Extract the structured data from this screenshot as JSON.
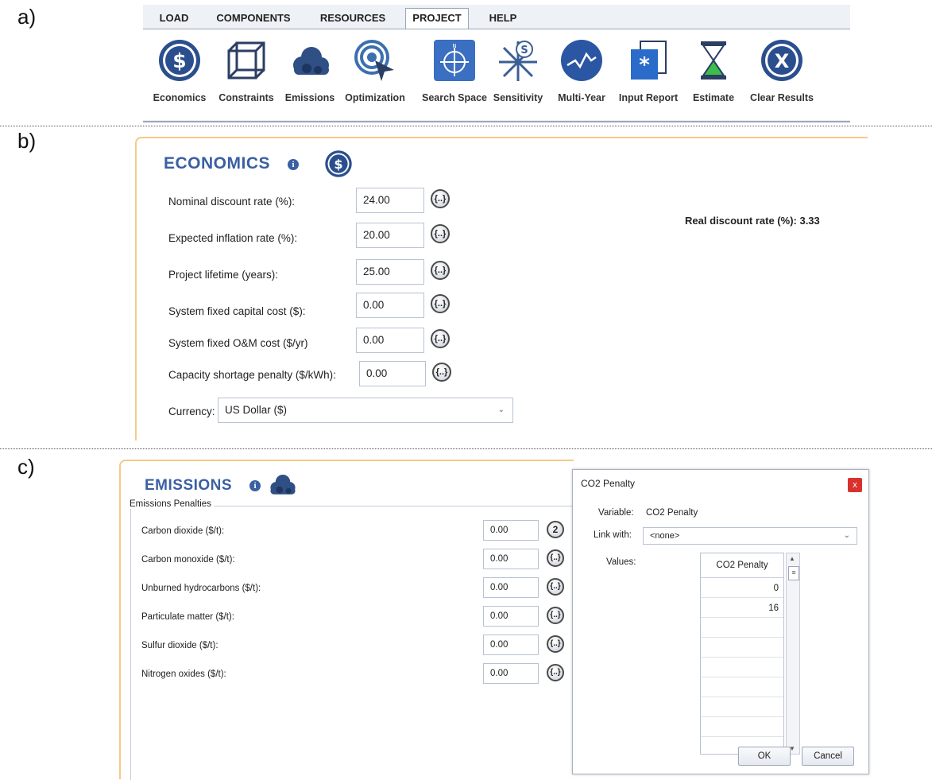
{
  "panel_labels": {
    "a": "a)",
    "b": "b)",
    "c": "c)"
  },
  "ribbon": {
    "tabs": [
      "LOAD",
      "COMPONENTS",
      "RESOURCES",
      "PROJECT",
      "HELP"
    ],
    "active_tab": "PROJECT",
    "buttons": [
      {
        "label": "Economics",
        "icon": "dollar-icon"
      },
      {
        "label": "Constraints",
        "icon": "cube-icon"
      },
      {
        "label": "Emissions",
        "icon": "cloud-icon"
      },
      {
        "label": "Optimization",
        "icon": "target-cursor-icon"
      },
      {
        "label": "Search Space",
        "icon": "compass-icon"
      },
      {
        "label": "Sensitivity",
        "icon": "sensitivity-icon"
      },
      {
        "label": "Multi-Year",
        "icon": "chart-line-icon"
      },
      {
        "label": "Input Report",
        "icon": "report-icon"
      },
      {
        "label": "Estimate",
        "icon": "hourglass-icon"
      },
      {
        "label": "Clear Results",
        "icon": "x-clear-icon"
      }
    ]
  },
  "economics": {
    "title": "ECONOMICS",
    "fields": [
      {
        "label": "Nominal discount rate (%):",
        "value": "24.00"
      },
      {
        "label": "Expected inflation rate (%):",
        "value": "20.00"
      },
      {
        "label": "Project lifetime (years):",
        "value": "25.00"
      },
      {
        "label": "System fixed capital cost ($):",
        "value": "0.00"
      },
      {
        "label": "System fixed O&M cost ($/yr)",
        "value": "0.00"
      },
      {
        "label": "Capacity shortage penalty ($/kWh):",
        "value": "0.00"
      }
    ],
    "sensitivity_button": "{..}",
    "currency_label": "Currency:",
    "currency_value": "US Dollar ($)",
    "real_discount_rate": "Real discount rate (%): 3.33"
  },
  "emissions": {
    "title": "EMISSIONS",
    "group_title": "Emissions Penalties",
    "fields": [
      {
        "label": "Carbon dioxide ($/t):",
        "value": "0.00",
        "sens": "2"
      },
      {
        "label": "Carbon monoxide ($/t):",
        "value": "0.00",
        "sens": "{..}"
      },
      {
        "label": "Unburned hydrocarbons ($/t):",
        "value": "0.00",
        "sens": "{..}"
      },
      {
        "label": "Particulate matter ($/t):",
        "value": "0.00",
        "sens": "{..}"
      },
      {
        "label": "Sulfur dioxide ($/t):",
        "value": "0.00",
        "sens": "{..}"
      },
      {
        "label": "Nitrogen oxides ($/t):",
        "value": "0.00",
        "sens": "{..}"
      }
    ]
  },
  "dialog": {
    "title": "CO2 Penalty",
    "close": "x",
    "variable_label": "Variable:",
    "variable_value": "CO2 Penalty",
    "link_label": "Link with:",
    "link_value": "<none>",
    "values_label": "Values:",
    "column_header": "CO2 Penalty",
    "values": [
      "0",
      "16",
      "",
      "",
      "",
      "",
      "",
      "",
      ""
    ],
    "ok": "OK",
    "cancel": "Cancel"
  },
  "colors": {
    "accent_blue": "#3a5fa3",
    "panel_border": "#f5c98a",
    "close_red": "#d9322e"
  }
}
